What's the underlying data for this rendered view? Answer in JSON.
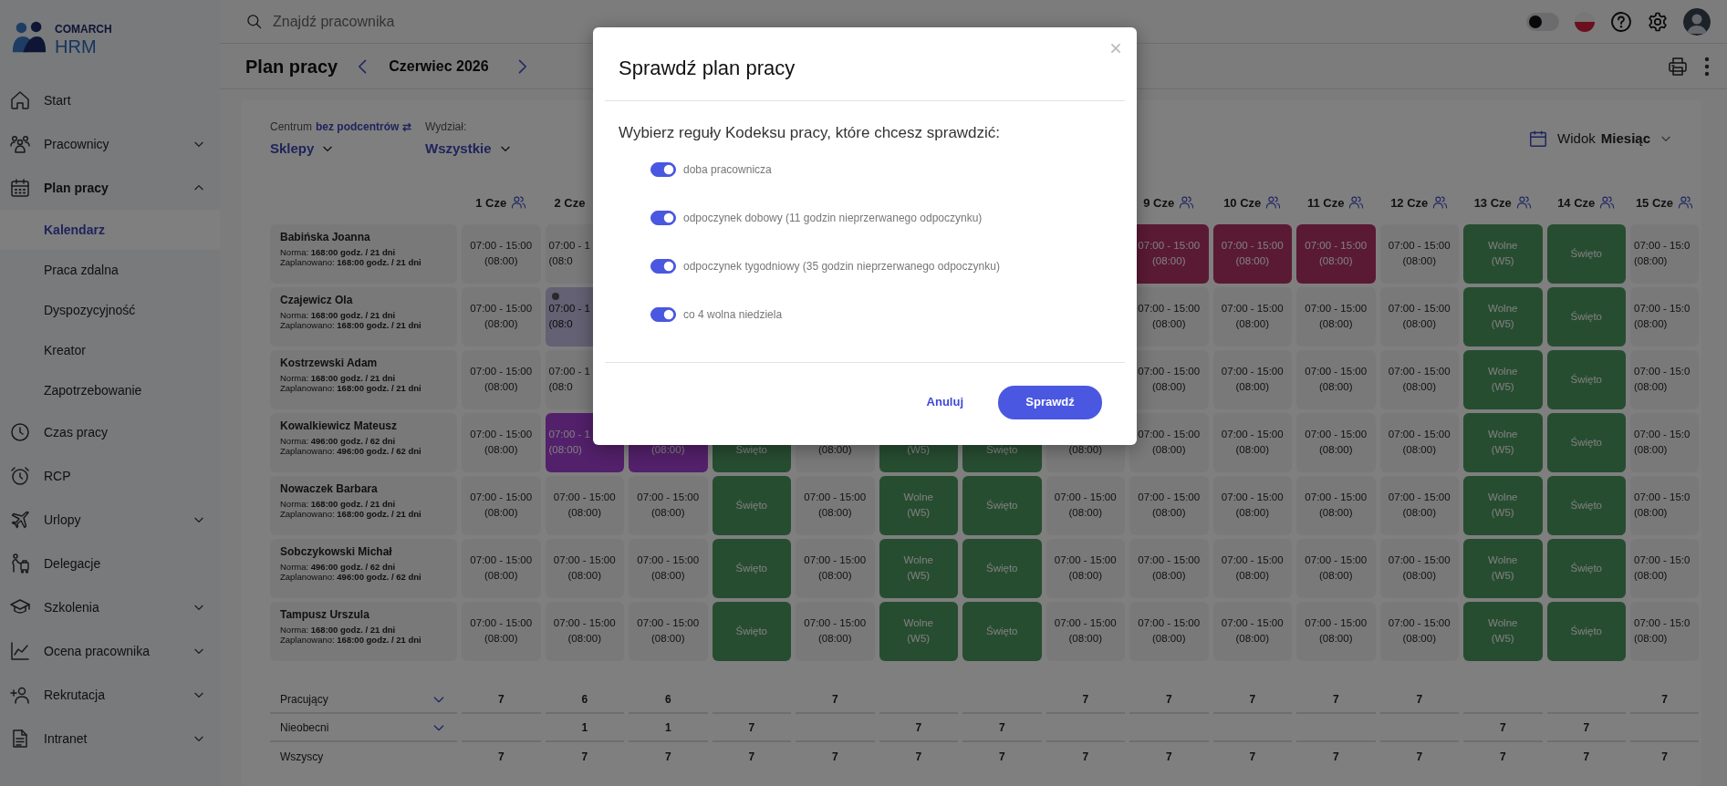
{
  "sidebar": {
    "logo": {
      "brand": "COMARCH",
      "product": "HRM"
    },
    "items": [
      {
        "label": "Start",
        "selected": false
      },
      {
        "label": "Pracownicy",
        "selected": false,
        "expanded": false
      },
      {
        "label": "Plan pracy",
        "selected": false,
        "expanded": true,
        "children": [
          {
            "label": "Kalendarz",
            "selected": true
          },
          {
            "label": "Praca zdalna",
            "selected": false
          },
          {
            "label": "Dyspozycyjność",
            "selected": false
          },
          {
            "label": "Kreator",
            "selected": false
          },
          {
            "label": "Zapotrzebowanie",
            "selected": false
          }
        ]
      },
      {
        "label": "Czas pracy",
        "selected": false
      },
      {
        "label": "RCP",
        "selected": false
      },
      {
        "label": "Urlopy",
        "selected": false,
        "expanded": false
      },
      {
        "label": "Delegacje",
        "selected": false
      },
      {
        "label": "Szkolenia",
        "selected": false,
        "expanded": false
      },
      {
        "label": "Ocena pracownika",
        "selected": false,
        "expanded": false
      },
      {
        "label": "Rekrutacja",
        "selected": false,
        "expanded": false
      },
      {
        "label": "Intranet",
        "selected": false,
        "expanded": false
      }
    ]
  },
  "topbar": {
    "search": {
      "placeholder": "Znajdź pracownika"
    },
    "dark_mode": {
      "on": false
    }
  },
  "header": {
    "title": "Plan pracy",
    "period": "Czerwiec 2026"
  },
  "filters": [
    {
      "label": "Centrum",
      "link": "bez podcentrów ⇄",
      "value": "Sklepy"
    },
    {
      "label": "Wydział:",
      "value": "Wszystkie"
    }
  ],
  "view": {
    "label": "Widok",
    "value": "Miesiąc"
  },
  "schedule": {
    "columns": [
      {
        "label": "1 Cze"
      },
      {
        "label": "2 Cze",
        "cut": true
      },
      {},
      {},
      {},
      {},
      {},
      {},
      {
        "label": "9 Cze"
      },
      {
        "label": "10 Cze"
      },
      {
        "label": "11 Cze"
      },
      {
        "label": "12 Cze"
      },
      {
        "label": "13 Cze"
      },
      {
        "label": "14 Cze"
      },
      {
        "label": "15 Cze"
      }
    ],
    "rows": [
      {
        "name": "Babińska Joanna",
        "norm": "Norma: **168:00 godz. / 21 dni**",
        "planned": "Zaplanowano: **168:00 godz. / 21 dni**",
        "cells": [
          {
            "kind": "shift",
            "lines": [
              "07:00 - 15:00",
              "(08:00)"
            ]
          },
          {
            "kind": "shift",
            "cut": true,
            "lines": [
              "07:00 - 1",
              "(08:0"
            ]
          },
          {},
          {},
          {},
          {},
          {},
          {},
          {
            "kind": "violation",
            "lines": [
              "07:00 - 15:00",
              "(08:00)"
            ]
          },
          {
            "kind": "violation",
            "lines": [
              "07:00 - 15:00",
              "(08:00)"
            ]
          },
          {
            "kind": "violation",
            "lines": [
              "07:00 - 15:00",
              "(08:00)"
            ]
          },
          {
            "kind": "shift",
            "lines": [
              "07:00 - 15:00",
              "(08:00)"
            ]
          },
          {
            "kind": "day_off",
            "lines": [
              "Wolne",
              "(W5)"
            ]
          },
          {
            "kind": "holiday",
            "lines": [
              "Święto"
            ]
          },
          {
            "kind": "shift",
            "cut": true,
            "lines": [
              "07:00 - 15:0",
              "(08:00)"
            ]
          }
        ]
      },
      {
        "name": "Czajewicz Ola",
        "norm": "Norma: **168:00 godz. / 21 dni**",
        "planned": "Zaplanowano: **168:00 godz. / 21 dni**",
        "cells": [
          {
            "kind": "shift",
            "lines": [
              "07:00 - 15:00",
              "(08:00)"
            ]
          },
          {
            "kind": "pending",
            "cut": true,
            "lines": [
              "07:00 - 1",
              "(08:0"
            ]
          },
          {},
          {},
          {},
          {},
          {},
          {},
          {
            "kind": "shift",
            "lines": [
              "07:00 - 15:00",
              "(08:00)"
            ]
          },
          {
            "kind": "shift",
            "lines": [
              "07:00 - 15:00",
              "(08:00)"
            ]
          },
          {
            "kind": "shift",
            "lines": [
              "07:00 - 15:00",
              "(08:00)"
            ]
          },
          {
            "kind": "shift",
            "lines": [
              "07:00 - 15:00",
              "(08:00)"
            ]
          },
          {
            "kind": "day_off",
            "lines": [
              "Wolne",
              "(W5)"
            ]
          },
          {
            "kind": "holiday",
            "lines": [
              "Święto"
            ]
          },
          {
            "kind": "shift",
            "cut": true,
            "lines": [
              "07:00 - 15:0",
              "(08:00)"
            ]
          }
        ]
      },
      {
        "name": "Kostrzewski Adam",
        "norm": "Norma: **168:00 godz. / 21 dni**",
        "planned": "Zaplanowano: **168:00 godz. / 21 dni**",
        "cells": [
          {
            "kind": "shift",
            "lines": [
              "07:00 - 15:00",
              "(08:00)"
            ]
          },
          {
            "kind": "shift",
            "cut": true,
            "lines": [
              "07:00 - 1",
              "(08:0"
            ]
          },
          {},
          {},
          {},
          {},
          {},
          {},
          {
            "kind": "shift",
            "lines": [
              "07:00 - 15:00",
              "(08:00)"
            ]
          },
          {
            "kind": "shift",
            "lines": [
              "07:00 - 15:00",
              "(08:00)"
            ]
          },
          {
            "kind": "shift",
            "lines": [
              "07:00 - 15:00",
              "(08:00)"
            ]
          },
          {
            "kind": "shift",
            "lines": [
              "07:00 - 15:00",
              "(08:00)"
            ]
          },
          {
            "kind": "day_off",
            "lines": [
              "Wolne",
              "(W5)"
            ]
          },
          {
            "kind": "holiday",
            "lines": [
              "Święto"
            ]
          },
          {
            "kind": "shift",
            "cut": true,
            "lines": [
              "07:00 - 15:0",
              "(08:00)"
            ]
          }
        ]
      },
      {
        "name": "Kowalkiewicz Mateusz",
        "norm": "Norma: **496:00 godz. / 62 dni**",
        "planned": "Zaplanowano: **496:00 godz. / 62 dni**",
        "cells": [
          {
            "kind": "shift",
            "lines": [
              "07:00 - 15:00",
              "(08:00)"
            ]
          },
          {
            "kind": "leave",
            "cut": true,
            "lines": [
              "07:00 - 1",
              "(08:00)"
            ]
          },
          {
            "kind": "leave",
            "covered_top": true,
            "lines": [
              "(08:00)"
            ]
          },
          {
            "kind": "holiday",
            "covered_top": true,
            "lines": [
              "Święto"
            ]
          },
          {
            "kind": "shift",
            "covered_top": true,
            "lines": [
              "(08:00)"
            ]
          },
          {
            "kind": "day_off",
            "covered_top": true,
            "lines": [
              "(W5)"
            ]
          },
          {
            "kind": "holiday",
            "covered_top": true,
            "lines": [
              "Święto"
            ]
          },
          {
            "kind": "shift",
            "covered_top": true,
            "lines": [
              "(08:00)"
            ]
          },
          {
            "kind": "shift",
            "lines": [
              "07:00 - 15:00",
              "(08:00)"
            ]
          },
          {
            "kind": "shift",
            "lines": [
              "07:00 - 15:00",
              "(08:00)"
            ]
          },
          {
            "kind": "shift",
            "lines": [
              "07:00 - 15:00",
              "(08:00)"
            ]
          },
          {
            "kind": "shift",
            "lines": [
              "07:00 - 15:00",
              "(08:00)"
            ]
          },
          {
            "kind": "day_off",
            "lines": [
              "Wolne",
              "(W5)"
            ]
          },
          {
            "kind": "holiday",
            "lines": [
              "Święto"
            ]
          },
          {
            "kind": "shift",
            "cut": true,
            "lines": [
              "07:00 - 15:0",
              "(08:00)"
            ]
          }
        ]
      },
      {
        "name": "Nowaczek Barbara",
        "norm": "Norma: **168:00 godz. / 21 dni**",
        "planned": "Zaplanowano: **168:00 godz. / 21 dni**",
        "cells": [
          {
            "kind": "shift",
            "lines": [
              "07:00 - 15:00",
              "(08:00)"
            ]
          },
          {
            "kind": "shift",
            "lines": [
              "07:00 - 15:00",
              "(08:00)"
            ]
          },
          {
            "kind": "shift",
            "lines": [
              "07:00 - 15:00",
              "(08:00)"
            ]
          },
          {
            "kind": "holiday",
            "lines": [
              "Święto"
            ]
          },
          {
            "kind": "shift",
            "lines": [
              "07:00 - 15:00",
              "(08:00)"
            ]
          },
          {
            "kind": "day_off",
            "lines": [
              "Wolne",
              "(W5)"
            ]
          },
          {
            "kind": "holiday",
            "lines": [
              "Święto"
            ]
          },
          {
            "kind": "shift",
            "lines": [
              "07:00 - 15:00",
              "(08:00)"
            ]
          },
          {
            "kind": "shift",
            "lines": [
              "07:00 - 15:00",
              "(08:00)"
            ]
          },
          {
            "kind": "shift",
            "lines": [
              "07:00 - 15:00",
              "(08:00)"
            ]
          },
          {
            "kind": "shift",
            "lines": [
              "07:00 - 15:00",
              "(08:00)"
            ]
          },
          {
            "kind": "shift",
            "lines": [
              "07:00 - 15:00",
              "(08:00)"
            ]
          },
          {
            "kind": "day_off",
            "lines": [
              "Wolne",
              "(W5)"
            ]
          },
          {
            "kind": "holiday",
            "lines": [
              "Święto"
            ]
          },
          {
            "kind": "shift",
            "cut": true,
            "lines": [
              "07:00 - 15:0",
              "(08:00)"
            ]
          }
        ]
      },
      {
        "name": "Sobczykowski Michał",
        "norm": "Norma: **496:00 godz. / 62 dni**",
        "planned": "Zaplanowano: **496:00 godz. / 62 dni**",
        "cells": [
          {
            "kind": "shift",
            "lines": [
              "07:00 - 15:00",
              "(08:00)"
            ]
          },
          {
            "kind": "shift",
            "lines": [
              "07:00 - 15:00",
              "(08:00)"
            ]
          },
          {
            "kind": "shift",
            "lines": [
              "07:00 - 15:00",
              "(08:00)"
            ]
          },
          {
            "kind": "holiday",
            "lines": [
              "Święto"
            ]
          },
          {
            "kind": "shift",
            "lines": [
              "07:00 - 15:00",
              "(08:00)"
            ]
          },
          {
            "kind": "day_off",
            "lines": [
              "Wolne",
              "(W5)"
            ]
          },
          {
            "kind": "holiday",
            "lines": [
              "Święto"
            ]
          },
          {
            "kind": "shift",
            "lines": [
              "07:00 - 15:00",
              "(08:00)"
            ]
          },
          {
            "kind": "shift",
            "lines": [
              "07:00 - 15:00",
              "(08:00)"
            ]
          },
          {
            "kind": "shift",
            "lines": [
              "07:00 - 15:00",
              "(08:00)"
            ]
          },
          {
            "kind": "shift",
            "lines": [
              "07:00 - 15:00",
              "(08:00)"
            ]
          },
          {
            "kind": "shift",
            "lines": [
              "07:00 - 15:00",
              "(08:00)"
            ]
          },
          {
            "kind": "day_off",
            "lines": [
              "Wolne",
              "(W5)"
            ]
          },
          {
            "kind": "holiday",
            "lines": [
              "Święto"
            ]
          },
          {
            "kind": "shift",
            "cut": true,
            "lines": [
              "07:00 - 15:0",
              "(08:00)"
            ]
          }
        ]
      },
      {
        "name": "Tampusz Urszula",
        "norm": "Norma: **168:00 godz. / 21 dni**",
        "planned": "Zaplanowano: **168:00 godz. / 21 dni**",
        "cells": [
          {
            "kind": "shift",
            "lines": [
              "07:00 - 15:00",
              "(08:00)"
            ]
          },
          {
            "kind": "shift",
            "lines": [
              "07:00 - 15:00",
              "(08:00)"
            ]
          },
          {
            "kind": "shift",
            "lines": [
              "07:00 - 15:00",
              "(08:00)"
            ]
          },
          {
            "kind": "holiday",
            "lines": [
              "Święto"
            ]
          },
          {
            "kind": "shift",
            "lines": [
              "07:00 - 15:00",
              "(08:00)"
            ]
          },
          {
            "kind": "day_off",
            "lines": [
              "Wolne",
              "(W5)"
            ]
          },
          {
            "kind": "holiday",
            "lines": [
              "Święto"
            ]
          },
          {
            "kind": "shift",
            "lines": [
              "07:00 - 15:00",
              "(08:00)"
            ]
          },
          {
            "kind": "shift",
            "lines": [
              "07:00 - 15:00",
              "(08:00)"
            ]
          },
          {
            "kind": "shift",
            "lines": [
              "07:00 - 15:00",
              "(08:00)"
            ]
          },
          {
            "kind": "shift",
            "lines": [
              "07:00 - 15:00",
              "(08:00)"
            ]
          },
          {
            "kind": "shift",
            "lines": [
              "07:00 - 15:00",
              "(08:00)"
            ]
          },
          {
            "kind": "day_off",
            "lines": [
              "Wolne",
              "(W5)"
            ]
          },
          {
            "kind": "holiday",
            "lines": [
              "Święto"
            ]
          },
          {
            "kind": "shift",
            "cut": true,
            "lines": [
              "07:00 - 15:0",
              "(08:00)"
            ]
          }
        ]
      }
    ],
    "summary": [
      {
        "label": "Pracujący",
        "expanded": false,
        "values": [
          {
            "kind": "count",
            "value": "7"
          },
          {
            "kind": "count",
            "value": "6"
          },
          {
            "kind": "count",
            "value": "6"
          },
          {
            "kind": "none"
          },
          {
            "kind": "count",
            "value": "7"
          },
          {
            "kind": "none"
          },
          {
            "kind": "none"
          },
          {
            "kind": "count",
            "value": "7"
          },
          {
            "kind": "count",
            "value": "7"
          },
          {
            "kind": "count",
            "value": "7"
          },
          {
            "kind": "count",
            "value": "7"
          },
          {
            "kind": "count",
            "value": "7"
          },
          {
            "kind": "none"
          },
          {
            "kind": "none"
          },
          {
            "kind": "count",
            "value": "7"
          }
        ]
      },
      {
        "label": "Nieobecni",
        "expanded": false,
        "values": [
          {
            "kind": "none"
          },
          {
            "kind": "count",
            "value": "1"
          },
          {
            "kind": "count",
            "value": "1"
          },
          {
            "kind": "count",
            "value": "7"
          },
          {
            "kind": "none"
          },
          {
            "kind": "count",
            "value": "7"
          },
          {
            "kind": "count",
            "value": "7"
          },
          {
            "kind": "none"
          },
          {
            "kind": "none"
          },
          {
            "kind": "none"
          },
          {
            "kind": "none"
          },
          {
            "kind": "none"
          },
          {
            "kind": "count",
            "value": "7"
          },
          {
            "kind": "count",
            "value": "7"
          },
          {
            "kind": "none"
          }
        ]
      },
      {
        "label": "Wszyscy",
        "values": [
          {
            "kind": "count",
            "value": "7"
          },
          {
            "kind": "count",
            "value": "7"
          },
          {
            "kind": "count",
            "value": "7"
          },
          {
            "kind": "count",
            "value": "7"
          },
          {
            "kind": "count",
            "value": "7"
          },
          {
            "kind": "count",
            "value": "7"
          },
          {
            "kind": "count",
            "value": "7"
          },
          {
            "kind": "count",
            "value": "7"
          },
          {
            "kind": "count",
            "value": "7"
          },
          {
            "kind": "count",
            "value": "7"
          },
          {
            "kind": "count",
            "value": "7"
          },
          {
            "kind": "count",
            "value": "7"
          },
          {
            "kind": "count",
            "value": "7"
          },
          {
            "kind": "count",
            "value": "7"
          },
          {
            "kind": "count",
            "value": "7"
          }
        ]
      }
    ]
  },
  "dialog": {
    "title": "Sprawdź plan pracy",
    "question": "Wybierz reguły Kodeksu pracy, które chcesz sprawdzić:",
    "rules": [
      {
        "label": "doba pracownicza",
        "on": true
      },
      {
        "label": "odpoczynek dobowy (11 godzin nieprzerwanego odpoczynku)",
        "on": true
      },
      {
        "label": "odpoczynek tygodniowy (35 godzin nieprzerwanego odpoczynku)",
        "on": true
      },
      {
        "label": "co 4 wolna niedziela",
        "on": true
      }
    ],
    "buttons": [
      {
        "label": "Anuluj",
        "kind": "link"
      },
      {
        "label": "Sprawdź",
        "kind": "primary"
      }
    ]
  }
}
